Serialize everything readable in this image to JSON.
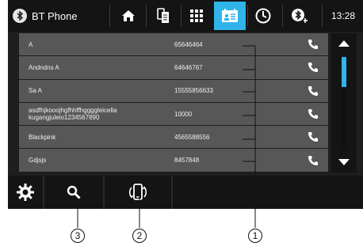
{
  "header": {
    "app_title": "BT Phone",
    "time": "13:28"
  },
  "contacts": [
    {
      "name": "A",
      "number": "65646464"
    },
    {
      "name": "Andndns A",
      "number": "64646767"
    },
    {
      "name": "Sa A",
      "number": "15555856633"
    },
    {
      "name": "asdfhjkooojhgfhhffhggggleicella kugangjuleio1234567890",
      "number": "10000"
    },
    {
      "name": "Blackpink",
      "number": "4565588556"
    },
    {
      "name": "Gdjsjs",
      "number": "8457848"
    }
  ],
  "callouts": {
    "one": "1",
    "two": "2",
    "three": "3"
  },
  "colors": {
    "accent": "#30b4ea",
    "row_bg": "#575757",
    "bar_bg": "#141414"
  },
  "scrollbar": {
    "position": 0
  }
}
